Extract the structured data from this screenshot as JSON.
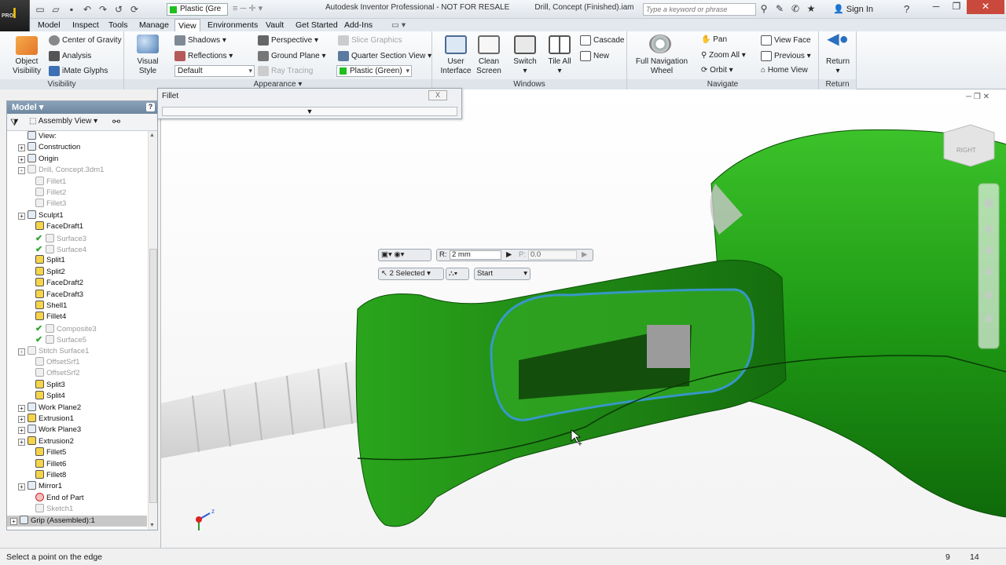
{
  "app": {
    "logo_letter": "I",
    "edition": "PRO"
  },
  "titlebar": {
    "material": "Plastic (Gre",
    "title_app": "Autodesk Inventor Professional - NOT FOR RESALE",
    "title_doc": "Drill, Concept (Finished).iam",
    "search_placeholder": "Type a keyword or phrase",
    "signin": "Sign In",
    "help": "?"
  },
  "tabs": [
    "Model",
    "Inspect",
    "Tools",
    "Manage",
    "View",
    "Environments",
    "Vault",
    "Get Started",
    "Add-Ins"
  ],
  "active_tab": "View",
  "ribbon": {
    "visibility": {
      "label": "Visibility",
      "object_visibility": "Object\nVisibility",
      "center_of_gravity": "Center of Gravity",
      "analysis": "Analysis",
      "imate_glyphs": "iMate Glyphs"
    },
    "appearance": {
      "label": "Appearance",
      "visual_style": "Visual Style",
      "shadows": "Shadows",
      "reflections": "Reflections",
      "default": "Default",
      "perspective": "Perspective",
      "ground_plane": "Ground Plane",
      "ray_tracing": "Ray Tracing",
      "slice_graphics": "Slice Graphics",
      "quarter_section": "Quarter Section View",
      "plastic_green": "Plastic (Green)"
    },
    "windows": {
      "label": "Windows",
      "user_interface": "User\nInterface",
      "clean_screen": "Clean\nScreen",
      "switch": "Switch",
      "tile_all": "Tile All",
      "cascade": "Cascade",
      "new": "New"
    },
    "navigate": {
      "label": "Navigate",
      "full_nav": "Full Navigation\nWheel",
      "pan": "Pan",
      "zoom_all": "Zoom All",
      "orbit": "Orbit",
      "view_face": "View Face",
      "previous": "Previous",
      "home_view": "Home View"
    },
    "return": {
      "label": "Return",
      "return": "Return"
    }
  },
  "browser": {
    "header": "Model",
    "view_mode": "Assembly View",
    "items": [
      {
        "label": "View:",
        "state": "normal",
        "indent": 1,
        "exp": false
      },
      {
        "label": "Construction",
        "state": "normal",
        "indent": 1,
        "exp": true
      },
      {
        "label": "Origin",
        "state": "normal",
        "indent": 1,
        "exp": true
      },
      {
        "label": "Drill, Concept.3dm1",
        "state": "gray",
        "indent": 1,
        "exp": true
      },
      {
        "label": "Fillet1",
        "state": "gray",
        "indent": 2,
        "exp": false
      },
      {
        "label": "Fillet2",
        "state": "gray",
        "indent": 2,
        "exp": false
      },
      {
        "label": "Fillet3",
        "state": "gray",
        "indent": 2,
        "exp": false
      },
      {
        "label": "Sculpt1",
        "state": "normal",
        "indent": 1,
        "exp": true
      },
      {
        "label": "FaceDraft1",
        "state": "normal",
        "indent": 2,
        "exp": false
      },
      {
        "label": "Surface3",
        "state": "gray",
        "indent": 2,
        "exp": false,
        "check": true
      },
      {
        "label": "Surface4",
        "state": "gray",
        "indent": 2,
        "exp": false,
        "check": true
      },
      {
        "label": "Split1",
        "state": "normal",
        "indent": 2,
        "exp": false
      },
      {
        "label": "Split2",
        "state": "normal",
        "indent": 2,
        "exp": false
      },
      {
        "label": "FaceDraft2",
        "state": "normal",
        "indent": 2,
        "exp": false
      },
      {
        "label": "FaceDraft3",
        "state": "normal",
        "indent": 2,
        "exp": false
      },
      {
        "label": "Shell1",
        "state": "normal",
        "indent": 2,
        "exp": false
      },
      {
        "label": "Fillet4",
        "state": "normal",
        "indent": 2,
        "exp": false
      },
      {
        "label": "Composite3",
        "state": "gray",
        "indent": 2,
        "exp": false,
        "check": true
      },
      {
        "label": "Surface5",
        "state": "gray",
        "indent": 2,
        "exp": false,
        "check": true
      },
      {
        "label": "Stitch Surface1",
        "state": "gray",
        "indent": 1,
        "exp": true
      },
      {
        "label": "OffsetSrf1",
        "state": "gray",
        "indent": 2,
        "exp": false
      },
      {
        "label": "OffsetSrf2",
        "state": "gray",
        "indent": 2,
        "exp": false
      },
      {
        "label": "Split3",
        "state": "normal",
        "indent": 2,
        "exp": false
      },
      {
        "label": "Split4",
        "state": "normal",
        "indent": 2,
        "exp": false
      },
      {
        "label": "Work Plane2",
        "state": "normal",
        "indent": 1,
        "exp": true
      },
      {
        "label": "Extrusion1",
        "state": "normal",
        "indent": 1,
        "exp": true
      },
      {
        "label": "Work Plane3",
        "state": "normal",
        "indent": 1,
        "exp": true
      },
      {
        "label": "Extrusion2",
        "state": "normal",
        "indent": 1,
        "exp": true
      },
      {
        "label": "Fillet5",
        "state": "normal",
        "indent": 2,
        "exp": false
      },
      {
        "label": "Fillet6",
        "state": "normal",
        "indent": 2,
        "exp": false
      },
      {
        "label": "Fillet8",
        "state": "normal",
        "indent": 2,
        "exp": false
      },
      {
        "label": "Mirror1",
        "state": "normal",
        "indent": 1,
        "exp": true
      },
      {
        "label": "End of Part",
        "state": "normal",
        "indent": 2,
        "exp": false,
        "end": true
      },
      {
        "label": "Sketch1",
        "state": "gray",
        "indent": 2,
        "exp": false
      },
      {
        "label": "Grip (Assembled):1",
        "state": "sel",
        "indent": 0,
        "exp": true
      }
    ]
  },
  "fillet_dialog": {
    "title": "Fillet",
    "close": "X"
  },
  "minitoolbar": {
    "r_label": "R:",
    "r_value": "2 mm",
    "p_label": "P:",
    "p_value": "0.0",
    "selected": "2 Selected",
    "start": "Start"
  },
  "viewcube": {
    "face": "RIGHT"
  },
  "status": {
    "message": "Select a point on the edge",
    "a": "9",
    "b": "14"
  },
  "colors": {
    "model_green": "#2e9e1e",
    "selected_edge": "#3a9ad9"
  }
}
